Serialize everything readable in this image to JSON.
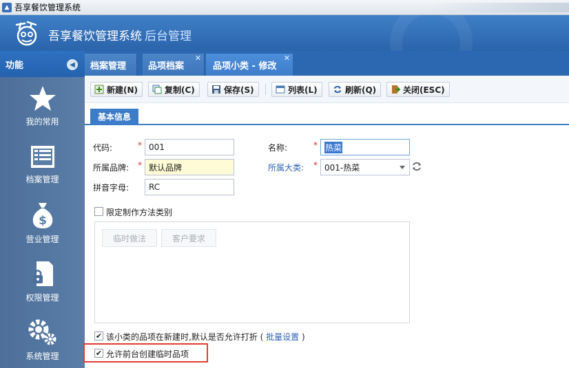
{
  "window": {
    "title": "吾享餐饮管理系统"
  },
  "app": {
    "name": "吾享餐饮管理系统",
    "subtitle": "后台管理"
  },
  "sidebar": {
    "header": "功能",
    "items": [
      {
        "label": "我的常用",
        "icon": "star-icon"
      },
      {
        "label": "档案管理",
        "icon": "file-list-icon"
      },
      {
        "label": "营业管理",
        "icon": "money-bag-icon"
      },
      {
        "label": "权限管理",
        "icon": "lock-document-icon"
      },
      {
        "label": "系统管理",
        "icon": "gears-icon"
      }
    ]
  },
  "tabs": [
    {
      "label": "档案管理",
      "active": false
    },
    {
      "label": "品项档案",
      "active": false,
      "close": "✕"
    },
    {
      "label": "品项小类 - 修改",
      "active": true,
      "close": "✕"
    }
  ],
  "toolbar": {
    "new_label": "新建(N)",
    "copy_label": "复制(C)",
    "save_label": "保存(S)",
    "list_label": "列表(L)",
    "refresh_label": "刷新(Q)",
    "close_label": "关闭(ESC)"
  },
  "section": {
    "title": "基本信息"
  },
  "form": {
    "code_label": "代码:",
    "code_value": "001",
    "name_label": "名称:",
    "name_value": "热菜",
    "brand_label": "所属品牌:",
    "brand_value": "默认品牌",
    "category_label": "所属大类:",
    "category_value": "001-热菜",
    "pinyin_label": "拼音字母:",
    "pinyin_value": "RC",
    "required_mark": "*"
  },
  "method_restrict": {
    "label": "限定制作方法类别",
    "checked": false
  },
  "method_buttons": [
    "临时做法",
    "客户要求"
  ],
  "discount_option": {
    "label": "该小类的品项在新建时,默认是否允许打折",
    "link": "批量设置",
    "paren_open": "(",
    "paren_close": ")",
    "checked": true
  },
  "temp_item_option": {
    "label": "允许前台创建临时品项",
    "checked": true
  },
  "checkmark": "✔",
  "colors": {
    "primary": "#2c68b2",
    "highlight": "#e23a30",
    "required": "#dd3333"
  }
}
